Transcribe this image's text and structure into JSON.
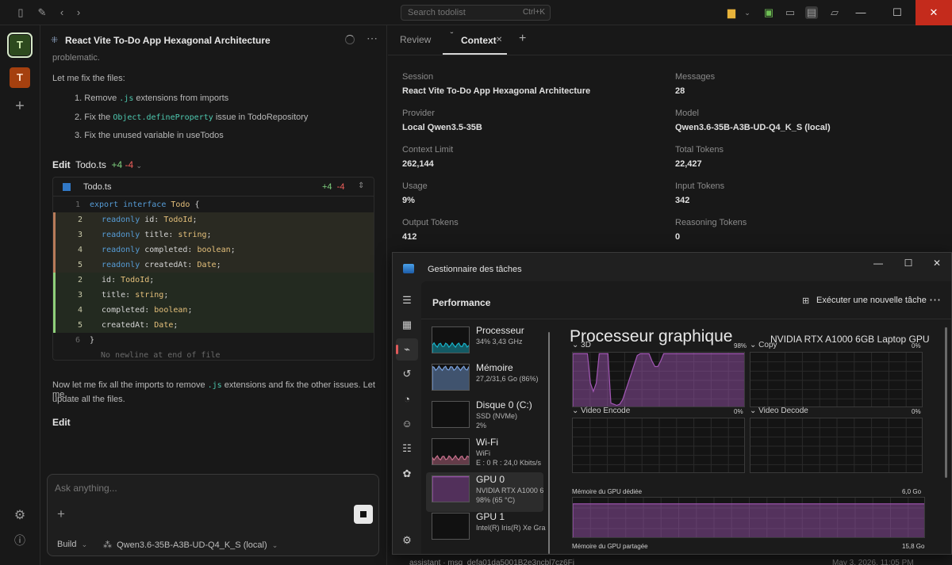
{
  "titlebar": {
    "search_placeholder": "Search todolist",
    "search_shortcut": "Ctrl+K"
  },
  "rail": {
    "projects": [
      {
        "initial": "T",
        "color": "#2d4a1e"
      },
      {
        "initial": "T",
        "color": "#a5400f"
      }
    ]
  },
  "chat": {
    "title": "React Vite To-Do App Hexagonal Architecture",
    "partial_text": "problematic.",
    "intro": "Let me fix the files:",
    "steps": [
      {
        "n": "1.",
        "pre": "Remove ",
        "code": ".js",
        "post": " extensions from imports"
      },
      {
        "n": "2.",
        "pre": "Fix the ",
        "code": "Object.defineProperty",
        "post": " issue in TodoRepository"
      },
      {
        "n": "3.",
        "pre": "Fix the unused variable in useTodos",
        "code": "",
        "post": ""
      }
    ],
    "edit_label": "Edit",
    "edit_file": "Todo.ts",
    "edit_add": "+4",
    "edit_del": "-4",
    "diff": {
      "file": "Todo.ts",
      "add": "+4",
      "del": "-4",
      "lines": [
        {
          "ln": "1",
          "kind": "ctx",
          "code": "export interface Todo {"
        },
        {
          "ln": "2",
          "kind": "rm",
          "code": "  readonly id: TodoId;"
        },
        {
          "ln": "3",
          "kind": "rm",
          "code": "  readonly title: string;"
        },
        {
          "ln": "4",
          "kind": "rm",
          "code": "  readonly completed: boolean;"
        },
        {
          "ln": "5",
          "kind": "rm",
          "code": "  readonly createdAt: Date;"
        },
        {
          "ln": "2",
          "kind": "ad",
          "code": "  id: TodoId;"
        },
        {
          "ln": "3",
          "kind": "ad",
          "code": "  title: string;"
        },
        {
          "ln": "4",
          "kind": "ad",
          "code": "  completed: boolean;"
        },
        {
          "ln": "5",
          "kind": "ad",
          "code": "  createdAt: Date;"
        },
        {
          "ln": "6",
          "kind": "ctx",
          "code": "}"
        }
      ],
      "note": "No newline at end of file"
    },
    "followup": "Now let me fix all the imports to remove",
    "followup_code": ".js",
    "followup_rest": "extensions and fix the other issues. Let me",
    "followup_line2": "update all the files.",
    "edit2_label": "Edit",
    "composer_placeholder": "Ask anything...",
    "mode": "Build",
    "model": "Qwen3.6-35B-A3B-UD-Q4_K_S (local)"
  },
  "context": {
    "tabs": {
      "review": "Review",
      "context": "Context"
    },
    "fields": [
      {
        "label": "Session",
        "value": "React Vite To-Do App Hexagonal Architecture"
      },
      {
        "label": "Messages",
        "value": "28"
      },
      {
        "label": "Provider",
        "value": "Local Qwen3.5-35B"
      },
      {
        "label": "Model",
        "value": "Qwen3.6-35B-A3B-UD-Q4_K_S (local)"
      },
      {
        "label": "Context Limit",
        "value": "262,144"
      },
      {
        "label": "Total Tokens",
        "value": "22,427"
      },
      {
        "label": "Usage",
        "value": "9%"
      },
      {
        "label": "Input Tokens",
        "value": "342"
      },
      {
        "label": "Output Tokens",
        "value": "412"
      },
      {
        "label": "Reasoning Tokens",
        "value": "0"
      }
    ],
    "meta_line": "assistant · msg_defa01da5001B2e3ncbl7cz6Fj",
    "meta_date": "May 3, 2026, 11:05 PM"
  },
  "taskmanager": {
    "title": "Gestionnaire des tâches",
    "heading": "Performance",
    "run_task": "Exécuter une nouvelle tâche",
    "resources": [
      {
        "name": "Processeur",
        "s1": "34%  3,43 GHz",
        "s2": "",
        "level": 0.34,
        "color": "#17b3c9"
      },
      {
        "name": "Mémoire",
        "s1": "27,2/31,6 Go (86%)",
        "s2": "",
        "level": 0.86,
        "color": "#7aa3e0"
      },
      {
        "name": "Disque 0 (C:)",
        "s1": "SSD (NVMe)",
        "s2": "2%",
        "level": 0.02,
        "color": "#6fbf55"
      },
      {
        "name": "Wi-Fi",
        "s1": "WiFi",
        "s2": "E : 0 R : 24,0 Kbits/s",
        "level": 0.3,
        "color": "#c9708d"
      },
      {
        "name": "GPU 0",
        "s1": "NVIDIA RTX A1000 6",
        "s2": "98%  (65 °C)",
        "level": 0.98,
        "color": "#a257b5"
      },
      {
        "name": "GPU 1",
        "s1": "Intel(R) Iris(R) Xe Gra",
        "s2": "",
        "level": 0.0,
        "color": "#a257b5"
      }
    ],
    "gpu_title": "Processeur graphique",
    "gpu_name": "NVIDIA RTX A1000 6GB Laptop GPU",
    "engines": [
      {
        "name": "3D",
        "pct": "98%",
        "level": 0.98
      },
      {
        "name": "Copy",
        "pct": "0%",
        "level": 0.0
      },
      {
        "name": "Video Encode",
        "pct": "0%",
        "level": 0.0
      },
      {
        "name": "Video Decode",
        "pct": "0%",
        "level": 0.0
      }
    ],
    "dedicated_label": "Mémoire du GPU dédiée",
    "dedicated_max": "6,0 Go",
    "dedicated_level": 0.85,
    "shared_label": "Mémoire du GPU partagée",
    "shared_max": "15,8 Go",
    "gpu_color": "#a257b5"
  }
}
